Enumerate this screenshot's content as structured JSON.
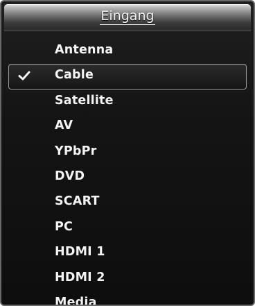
{
  "menu": {
    "title": "Eingang",
    "selected_index": 1,
    "items": [
      {
        "label": "Antenna",
        "checked": false
      },
      {
        "label": "Cable",
        "checked": true
      },
      {
        "label": "Satellite",
        "checked": false
      },
      {
        "label": "AV",
        "checked": false
      },
      {
        "label": "YPbPr",
        "checked": false
      },
      {
        "label": "DVD",
        "checked": false
      },
      {
        "label": "SCART",
        "checked": false
      },
      {
        "label": "PC",
        "checked": false
      },
      {
        "label": "HDMI 1",
        "checked": false
      },
      {
        "label": "HDMI 2",
        "checked": false
      },
      {
        "label": "Media",
        "checked": false
      }
    ]
  },
  "icons": {
    "check": "checkmark-icon"
  },
  "colors": {
    "background": "#141414",
    "text": "#f4f4f4",
    "selection_border": "#9a9a9a"
  }
}
